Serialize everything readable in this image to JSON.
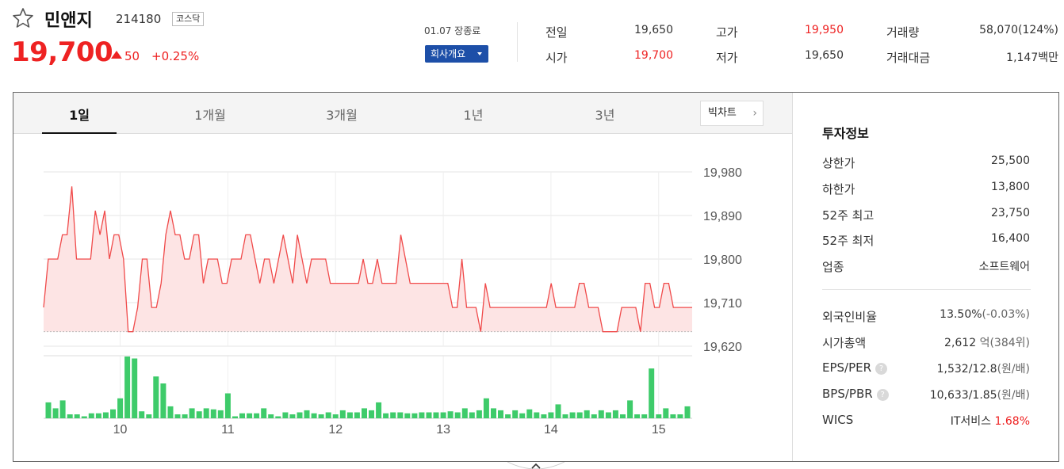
{
  "stock": {
    "name": "민앤지",
    "code": "214180",
    "market": "코스닥",
    "price": "19,700",
    "change": "50",
    "change_pct": "+0.25%",
    "date_status": "01.07 장종료",
    "company_button": "회사개요"
  },
  "summary": [
    {
      "label": "전일",
      "value": "19,650",
      "color": "normal"
    },
    {
      "label": "시가",
      "value": "19,700",
      "color": "red"
    },
    {
      "label": "고가",
      "value": "19,950",
      "color": "red"
    },
    {
      "label": "저가",
      "value": "19,650",
      "color": "normal"
    },
    {
      "label": "거래량",
      "value": "58,070(124%)",
      "color": "normal"
    },
    {
      "label": "거래대금",
      "value": "1,147백만",
      "color": "normal"
    }
  ],
  "tabs": [
    "1일",
    "1개월",
    "3개월",
    "1년",
    "3년"
  ],
  "active_tab": "1일",
  "big_chart_label": "빅차트",
  "investment": {
    "title": "투자정보",
    "rows": [
      {
        "label": "상한가",
        "value": "25,500",
        "color": "red"
      },
      {
        "label": "하한가",
        "value": "13,800",
        "color": "blue"
      },
      {
        "label": "52주 최고",
        "value": "23,750",
        "color": "normal"
      },
      {
        "label": "52주 최저",
        "value": "16,400",
        "color": "normal"
      },
      {
        "label": "업종",
        "value": "소프트웨어",
        "color": "normal"
      }
    ],
    "rows2": [
      {
        "label": "외국인비율",
        "value": "13.50%",
        "sub": "(-0.03%)"
      },
      {
        "label": "시가총액",
        "value": "2,612",
        "sub": "억(384위)"
      },
      {
        "label": "EPS/PER",
        "value": "1,532/12.8",
        "sub": "(원/배)",
        "help": "?"
      },
      {
        "label": "BPS/PBR",
        "value": "10,633/1.85",
        "sub": "(원/배)",
        "help": "?"
      },
      {
        "label": "WICS",
        "value": "IT서비스",
        "sub": "1.68%"
      }
    ]
  },
  "colors": {
    "up": "#e22222",
    "down": "#1d4fa8",
    "volume": "#3ecb6a",
    "area": "#fde4e4",
    "line": "#f04a4a"
  },
  "chart_data": {
    "type": "line",
    "ylim": [
      19620,
      19980
    ],
    "y_ticks": [
      "19,980",
      "19,890",
      "19,800",
      "19,710",
      "19,620"
    ],
    "x_ticks": [
      "10",
      "11",
      "12",
      "13",
      "14",
      "15"
    ],
    "x_tick_index": [
      10,
      25,
      40,
      55,
      70,
      85
    ],
    "prev_close": 19650,
    "price": [
      19700,
      19800,
      19800,
      19800,
      19850,
      19850,
      19950,
      19800,
      19800,
      19800,
      19800,
      19900,
      19850,
      19900,
      19800,
      19850,
      19850,
      19800,
      19650,
      19650,
      19700,
      19800,
      19800,
      19700,
      19700,
      19750,
      19850,
      19900,
      19850,
      19850,
      19800,
      19800,
      19850,
      19850,
      19750,
      19800,
      19800,
      19800,
      19750,
      19750,
      19800,
      19800,
      19800,
      19850,
      19850,
      19800,
      19750,
      19800,
      19800,
      19750,
      19800,
      19850,
      19800,
      19750,
      19850,
      19800,
      19750,
      19800,
      19800,
      19800,
      19800,
      19750,
      19750,
      19750,
      19750,
      19750,
      19750,
      19750,
      19800,
      19750,
      19750,
      19800,
      19750,
      19750,
      19750,
      19750,
      19850,
      19800,
      19750,
      19750,
      19750,
      19750,
      19750,
      19750,
      19750,
      19750,
      19750,
      19700,
      19700,
      19800,
      19700,
      19700,
      19700,
      19650,
      19750,
      19700,
      19700,
      19700,
      19700,
      19700,
      19700,
      19700,
      19700,
      19700,
      19700,
      19700,
      19700,
      19700,
      19750,
      19700,
      19700,
      19700,
      19700,
      19700,
      19750,
      19750,
      19700,
      19700,
      19700,
      19650,
      19650,
      19650,
      19650,
      19700,
      19700,
      19700,
      19700,
      19650,
      19750,
      19750,
      19700,
      19700,
      19750,
      19750,
      19700,
      19700,
      19700,
      19700,
      19700
    ],
    "volume": [
      16,
      10,
      18,
      4,
      4,
      2,
      5,
      5,
      6,
      9,
      20,
      62,
      60,
      7,
      4,
      42,
      35,
      12,
      4,
      4,
      10,
      7,
      10,
      9,
      8,
      25,
      2,
      5,
      5,
      5,
      10,
      4,
      2,
      6,
      4,
      6,
      8,
      5,
      4,
      6,
      4,
      8,
      6,
      6,
      10,
      8,
      16,
      5,
      6,
      6,
      5,
      5,
      6,
      6,
      6,
      6,
      7,
      6,
      10,
      6,
      8,
      20,
      10,
      8,
      4,
      8,
      5,
      9,
      6,
      4,
      6,
      14,
      4,
      6,
      6,
      8,
      4,
      8,
      6,
      8,
      4,
      18,
      4,
      4,
      50,
      4,
      10,
      4,
      4,
      12
    ]
  }
}
